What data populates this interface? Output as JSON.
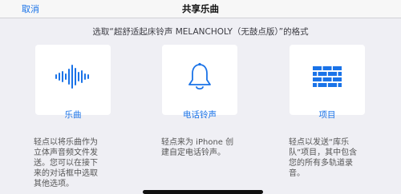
{
  "header": {
    "cancel_label": "取消",
    "title": "共享乐曲"
  },
  "prompt": "选取“超舒适起床铃声 MELANCHOLY（无鼓点版）”的格式",
  "accent_color": "#1a73e8",
  "options": [
    {
      "icon": "waveform-icon",
      "label": "乐曲",
      "description": "轻点以将乐曲作为\n立体声音频文件发\n送。您可以在接下\n来的对话框中选取\n其他选项。"
    },
    {
      "icon": "bell-icon",
      "label": "电话铃声",
      "description": "轻点来为 iPhone 创\n建自定电话铃声。"
    },
    {
      "icon": "bricks-icon",
      "label": "项目",
      "description": "轻点以发送“库乐\n队”项目，其中包含\n您的所有多轨道录\n音。"
    }
  ]
}
